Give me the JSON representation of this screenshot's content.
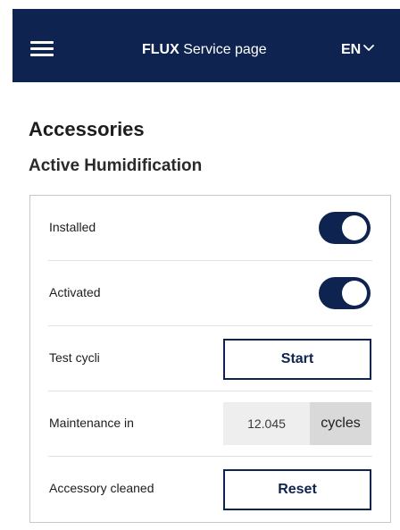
{
  "header": {
    "brand": "FLUX",
    "title": "Service page",
    "language": "EN",
    "menu_icon": "hamburger-icon",
    "language_icon": "chevron-down-icon",
    "background_color": "#0f2350"
  },
  "section": {
    "title": "Accessories",
    "subtitle": "Active Humidification"
  },
  "rows": [
    {
      "label": "Installed",
      "control": "toggle",
      "on": true
    },
    {
      "label": "Activated",
      "control": "toggle",
      "on": true
    },
    {
      "label": "Test cycli",
      "control": "button",
      "button_label": "Start"
    },
    {
      "label": "Maintenance in",
      "control": "stepper",
      "value": "12.045",
      "unit": "cycles"
    },
    {
      "label": "Accessory cleaned",
      "control": "button",
      "button_label": "Reset"
    }
  ],
  "colors": {
    "accent": "#0f2350",
    "stepper_value_bg": "#eeeeee",
    "stepper_unit_bg": "#d9d9d9",
    "border": "#c8c8c8"
  }
}
